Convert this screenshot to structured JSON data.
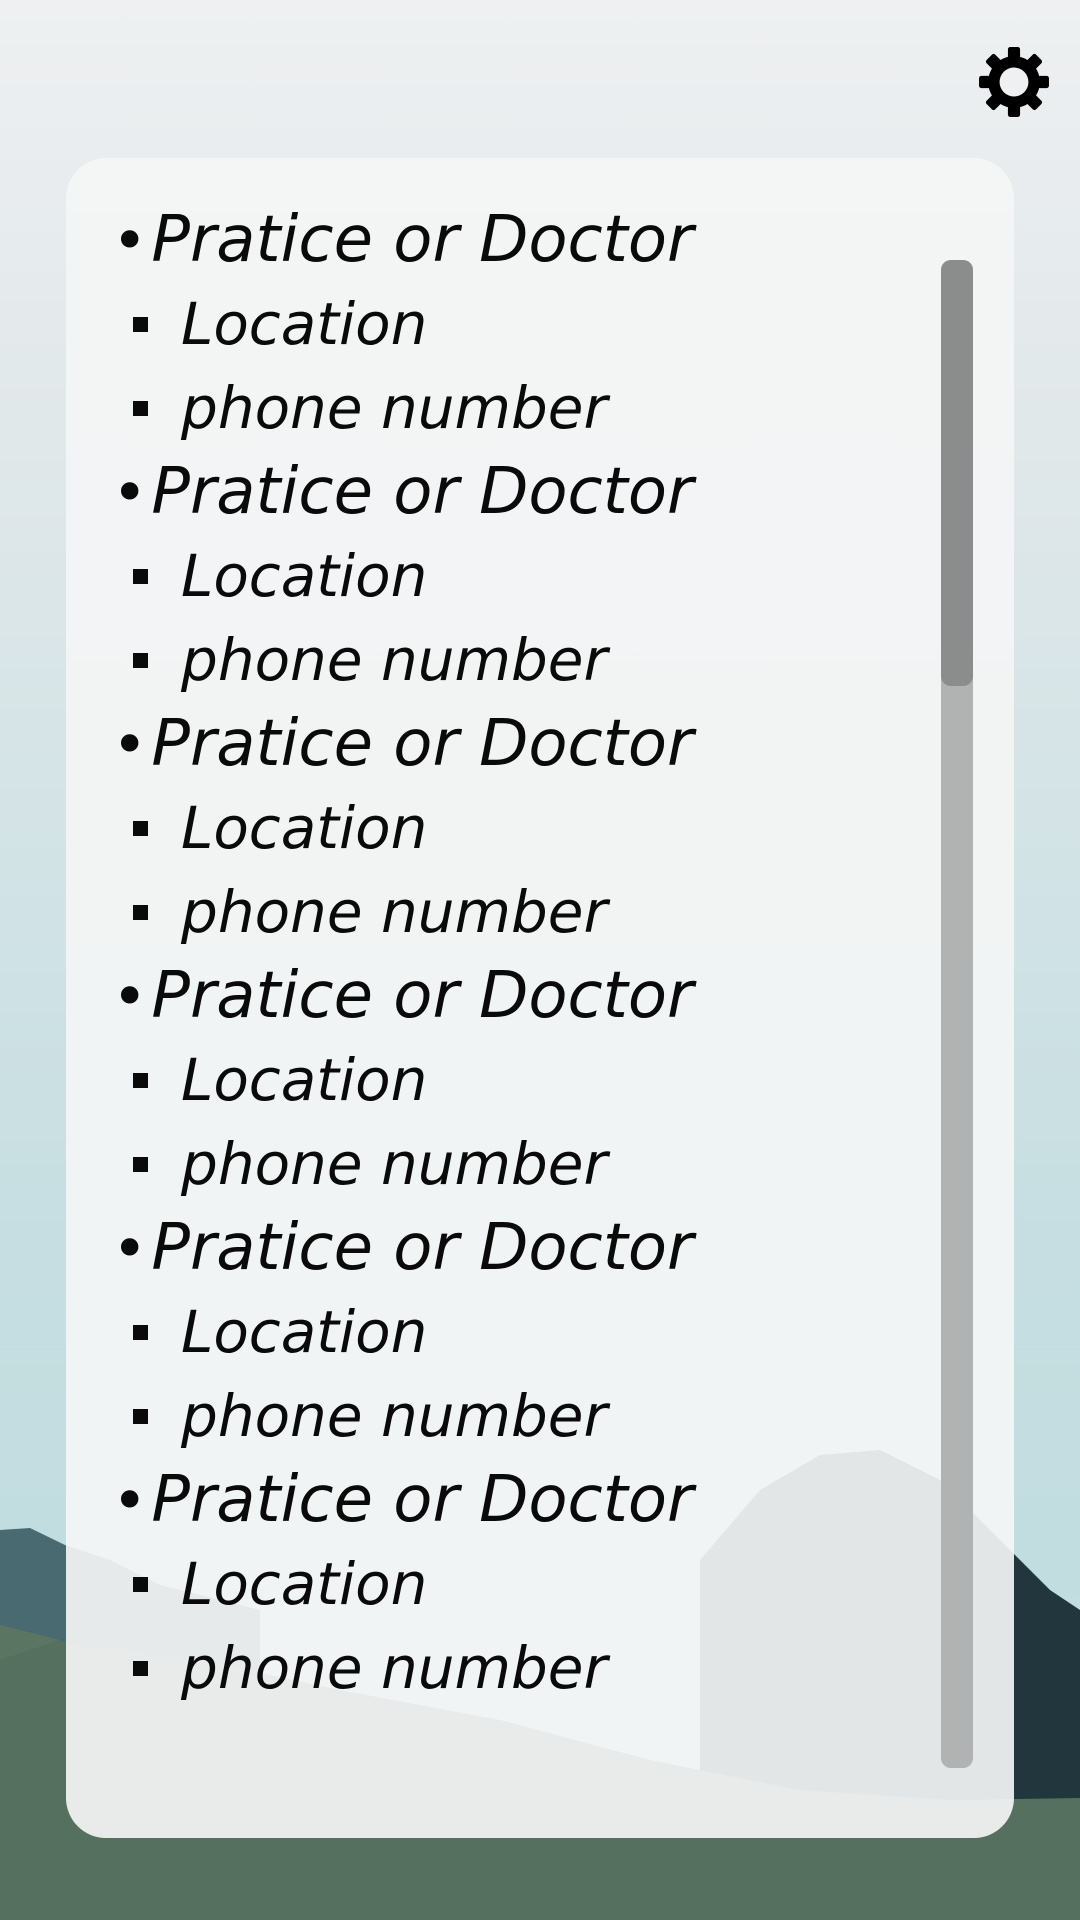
{
  "toolbar": {
    "settings_icon": "gear-icon"
  },
  "entries": [
    {
      "title": "Pratice or Doctor",
      "location": "Location",
      "phone": "phone number"
    },
    {
      "title": "Pratice or Doctor",
      "location": "Location",
      "phone": "phone number"
    },
    {
      "title": "Pratice or Doctor",
      "location": "Location",
      "phone": "phone number"
    },
    {
      "title": "Pratice or Doctor",
      "location": "Location",
      "phone": "phone number"
    },
    {
      "title": "Pratice or Doctor",
      "location": "Location",
      "phone": "phone number"
    },
    {
      "title": "Pratice or Doctor",
      "location": "Location",
      "phone": "phone number"
    }
  ],
  "list": {
    "bullet": "•"
  },
  "colors": {
    "text": "#0a0a0a",
    "panel": "#f4f5f5",
    "scroll_track": "#b1b2b2",
    "scroll_thumb": "#8b8c8c",
    "hill_dark": "#22373d",
    "grass": "#56705f"
  }
}
